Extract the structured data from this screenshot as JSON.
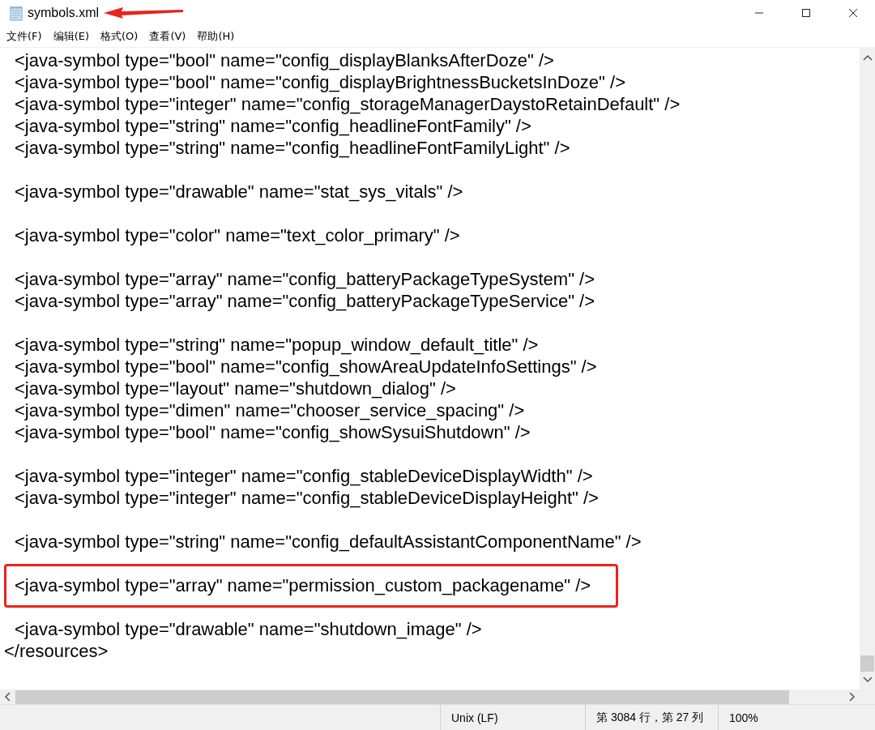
{
  "window": {
    "title": "symbols.xml"
  },
  "menu": [
    "文件(F)",
    "编辑(E)",
    "格式(O)",
    "查看(V)",
    "帮助(H)"
  ],
  "lines": [
    {
      "kind": "code",
      "text": "<java-symbol type=\"bool\" name=\"config_displayBlanksAfterDoze\" />",
      "highlighted": false
    },
    {
      "kind": "code",
      "text": "<java-symbol type=\"bool\" name=\"config_displayBrightnessBucketsInDoze\" />",
      "highlighted": false
    },
    {
      "kind": "code",
      "text": "<java-symbol type=\"integer\" name=\"config_storageManagerDaystoRetainDefault\" />",
      "highlighted": false
    },
    {
      "kind": "code",
      "text": "<java-symbol type=\"string\" name=\"config_headlineFontFamily\" />",
      "highlighted": false
    },
    {
      "kind": "code",
      "text": "<java-symbol type=\"string\" name=\"config_headlineFontFamilyLight\" />",
      "highlighted": false
    },
    {
      "kind": "blank",
      "highlighted": false
    },
    {
      "kind": "code",
      "text": "<java-symbol type=\"drawable\" name=\"stat_sys_vitals\" />",
      "highlighted": false
    },
    {
      "kind": "blank",
      "highlighted": false
    },
    {
      "kind": "code",
      "text": "<java-symbol type=\"color\" name=\"text_color_primary\" />",
      "highlighted": false
    },
    {
      "kind": "blank",
      "highlighted": false
    },
    {
      "kind": "code",
      "text": "<java-symbol type=\"array\" name=\"config_batteryPackageTypeSystem\" />",
      "highlighted": false
    },
    {
      "kind": "code",
      "text": "<java-symbol type=\"array\" name=\"config_batteryPackageTypeService\" />",
      "highlighted": false
    },
    {
      "kind": "blank",
      "highlighted": false
    },
    {
      "kind": "code",
      "text": "<java-symbol type=\"string\" name=\"popup_window_default_title\" />",
      "highlighted": false
    },
    {
      "kind": "code",
      "text": "<java-symbol type=\"bool\" name=\"config_showAreaUpdateInfoSettings\" />",
      "highlighted": false
    },
    {
      "kind": "code",
      "text": "<java-symbol type=\"layout\" name=\"shutdown_dialog\" />",
      "highlighted": false
    },
    {
      "kind": "code",
      "text": "<java-symbol type=\"dimen\" name=\"chooser_service_spacing\" />",
      "highlighted": false
    },
    {
      "kind": "code",
      "text": "<java-symbol type=\"bool\" name=\"config_showSysuiShutdown\" />",
      "highlighted": false
    },
    {
      "kind": "blank",
      "highlighted": false
    },
    {
      "kind": "code",
      "text": "<java-symbol type=\"integer\" name=\"config_stableDeviceDisplayWidth\" />",
      "highlighted": false
    },
    {
      "kind": "code",
      "text": "<java-symbol type=\"integer\" name=\"config_stableDeviceDisplayHeight\" />",
      "highlighted": false
    },
    {
      "kind": "blank",
      "highlighted": false
    },
    {
      "kind": "code",
      "text": "<java-symbol type=\"string\" name=\"config_defaultAssistantComponentName\" />",
      "highlighted": false
    },
    {
      "kind": "blank",
      "highlighted": false
    },
    {
      "kind": "code",
      "text": "<java-symbol type=\"array\" name=\"permission_custom_packagename\" />",
      "highlighted": true
    },
    {
      "kind": "blank",
      "highlighted": false
    },
    {
      "kind": "code",
      "text": "<java-symbol type=\"drawable\" name=\"shutdown_image\" />",
      "highlighted": false
    },
    {
      "kind": "root",
      "text": "</resources>",
      "highlighted": false
    }
  ],
  "status_bar": {
    "line_ending": "Unix (LF)",
    "position": "第 3084 行，第 27 列",
    "zoom": "100%"
  }
}
